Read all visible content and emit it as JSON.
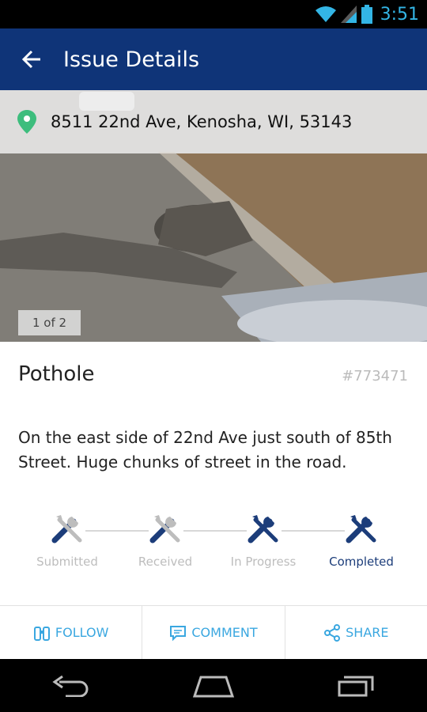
{
  "status": {
    "time": "3:51"
  },
  "header": {
    "title": "Issue Details"
  },
  "photo": {
    "address": "8511 22nd Ave, Kenosha, WI, 53143",
    "counter": "1 of 2"
  },
  "issue": {
    "title": "Pothole",
    "number": "#773471",
    "description": "On the east side of 22nd Ave just south of 85th Street. Huge chunks of street in the road."
  },
  "progress": {
    "steps": [
      {
        "label": "Submitted",
        "icon": "tools-icon"
      },
      {
        "label": "Received",
        "icon": "tools-icon"
      },
      {
        "label": "In Progress",
        "icon": "tools-icon"
      },
      {
        "label": "Completed",
        "icon": "tools-icon"
      }
    ],
    "current": "Completed",
    "active_color": "#1c3d7a",
    "inactive_color": "#bdbdbd"
  },
  "actions": {
    "follow": "FOLLOW",
    "comment": "COMMENT",
    "share": "SHARE"
  },
  "colors": {
    "app_bar": "#0f3478",
    "accent": "#3aa7e0",
    "pin": "#3dbd7d"
  }
}
